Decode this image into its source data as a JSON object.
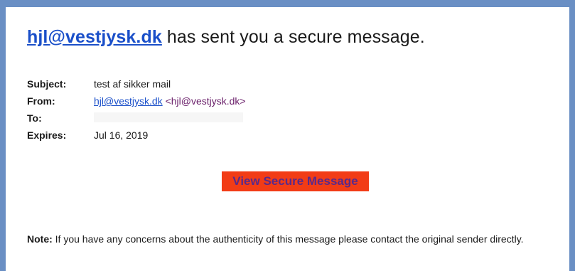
{
  "header": {
    "sender_link": "hjl@vestjysk.dk",
    "headline_text": " has sent you a secure message."
  },
  "meta": {
    "subject_label": "Subject:",
    "subject_value": "test af sikker mail",
    "from_label": "From:",
    "from_link": "hjl@vestjysk.dk",
    "from_addr": " <hjl@vestjysk.dk>",
    "to_label": "To:",
    "expires_label": "Expires:",
    "expires_value": "Jul 16, 2019"
  },
  "cta": {
    "label": "View Secure Message"
  },
  "note": {
    "label": "Note:",
    "text": " If you have any concerns about the authenticity of this message please contact the original sender directly."
  },
  "colors": {
    "link": "#1a4fc9",
    "cta_background": "#f23c16",
    "cta_text": "#5a2a8a",
    "frame_border": "#6a8fc4"
  }
}
